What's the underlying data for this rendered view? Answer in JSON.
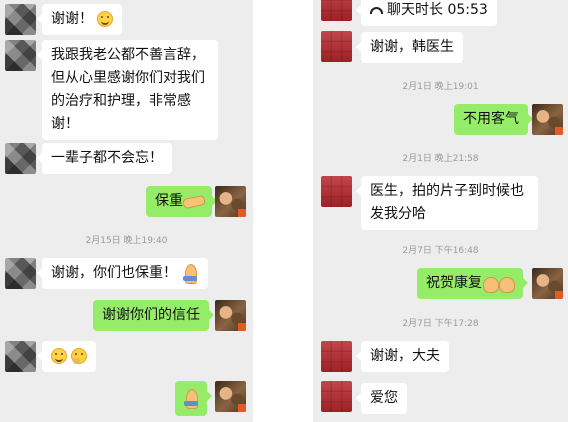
{
  "left": {
    "msg1": "谢谢！",
    "msg2": "我跟我老公都不善言辞，但从心里感谢你们对我们的治疗和护理，非常感谢！",
    "msg3": "一辈子都不会忘！",
    "msg4": "保重",
    "ts1": "2月15日 晚上19:40",
    "msg5": "谢谢，你们也保重！",
    "msg6": "谢谢你们的信任"
  },
  "right": {
    "call": "聊天时长 05:53",
    "msg1": "谢谢，韩医生",
    "ts1": "2月1日 晚上19:01",
    "msg2": "不用客气",
    "ts2": "2月1日 晚上21:58",
    "msg3": "医生，拍的片子到时候也发我分哈",
    "ts3": "2月7日 下午16:48",
    "msg4": "祝贺康复",
    "ts4": "2月7日 下午17:28",
    "msg5": "谢谢，大夫",
    "msg6": "爱您"
  },
  "icons": [
    "smile-emoji",
    "handshake-emoji",
    "pray-emoji",
    "thinking-emoji",
    "muscle-emoji",
    "call-icon"
  ]
}
